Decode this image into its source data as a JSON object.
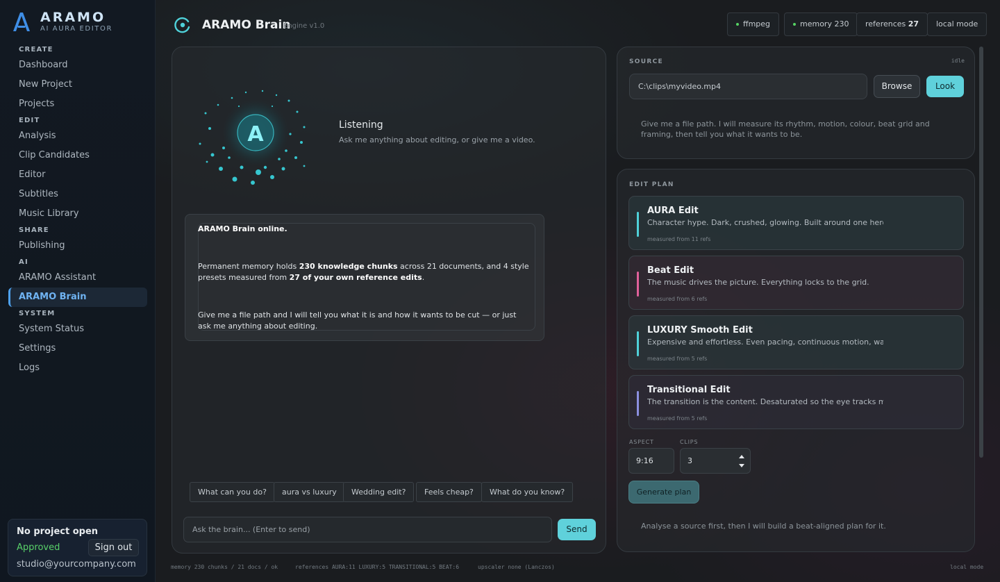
{
  "brand": {
    "name": "ARAMO",
    "subtitle": "AI AURA EDITOR"
  },
  "nav": {
    "sections": [
      {
        "label": "CREATE",
        "items": [
          "Dashboard",
          "New Project",
          "Projects"
        ]
      },
      {
        "label": "EDIT",
        "items": [
          "Analysis",
          "Clip Candidates",
          "Editor",
          "Subtitles",
          "Music Library"
        ]
      },
      {
        "label": "SHARE",
        "items": [
          "Publishing"
        ]
      },
      {
        "label": "AI",
        "items": [
          "ARAMO Assistant",
          "ARAMO Brain"
        ]
      },
      {
        "label": "SYSTEM",
        "items": [
          "System Status",
          "Settings",
          "Logs"
        ]
      }
    ],
    "active": "ARAMO Brain"
  },
  "account": {
    "title": "No project open",
    "status": "Approved",
    "email": "studio@yourcompany.com",
    "signout_label": "Sign out"
  },
  "header": {
    "title": "ARAMO Brain",
    "subtitle": "Engine v1.0",
    "pills": {
      "ffmpeg": "ffmpeg",
      "memory": "memory 230",
      "references_label": "references",
      "references_count": "27",
      "mode": "local mode"
    }
  },
  "chat": {
    "orb_letter": "A",
    "status_title": "Listening",
    "status_sub": "Ask me anything about editing, or give me a video.",
    "message": {
      "line1": "ARAMO Brain online.",
      "p2_a": "Permanent memory holds ",
      "p2_b": "230 knowledge chunks",
      "p2_c": " across 21 documents, and 4 style presets measured from ",
      "p2_d": "27 of your own reference edits",
      "p2_e": ".",
      "p3": "Give me a file path and I will tell you what it is and how it wants to be cut — or just ask me anything about editing."
    },
    "chips": [
      "What can you do?",
      "aura vs luxury",
      "Wedding edit?",
      "Feels cheap?",
      "What do you know?"
    ],
    "input_placeholder": "Ask the brain...  (Enter to send)",
    "send_label": "Send"
  },
  "source": {
    "label": "SOURCE",
    "state": "idle",
    "path_value": "C:\\clips\\myvideo.mp4",
    "browse_label": "Browse",
    "look_label": "Look",
    "description": "Give me a file path.  I will measure its rhythm, motion, colour, beat grid and framing, then tell you what it wants to be."
  },
  "edit_plan": {
    "label": "EDIT PLAN",
    "presets": [
      {
        "title": "AURA Edit",
        "desc": "Character hype. Dark, crushed, glowing. Built around one hero",
        "meta": "measured from 11 refs",
        "accent": "#4fd1d9"
      },
      {
        "title": "Beat Edit",
        "desc": "The music drives the picture. Everything locks to the grid.",
        "meta": "measured from 6 refs",
        "accent": "#e0609a"
      },
      {
        "title": "LUXURY Smooth Edit",
        "desc": "Expensive and effortless. Even pacing, continuous motion, warm",
        "meta": "measured from 5 refs",
        "accent": "#4fd1d9"
      },
      {
        "title": "Transitional Edit",
        "desc": "The transition is the content. Desaturated so the eye tracks m",
        "meta": "measured from 5 refs",
        "accent": "#8c8fe0"
      }
    ],
    "aspect_label": "ASPECT",
    "aspect_value": "9:16",
    "clips_label": "CLIPS",
    "clips_value": "3",
    "generate_label": "Generate plan",
    "footer": "Analyse a source first, then I will build a beat-aligned plan for it."
  },
  "status_bar": {
    "memory": "memory 230 chunks / 21 docs / ok",
    "references": "references AURA:11 LUXURY:5 TRANSITIONAL:5 BEAT:6",
    "upscaler": "upscaler none (Lanczos)",
    "mode": "local mode"
  },
  "colors": {
    "accent": "#5fd1db",
    "active_nav": "#6fb3f2",
    "ok": "#56d364"
  }
}
